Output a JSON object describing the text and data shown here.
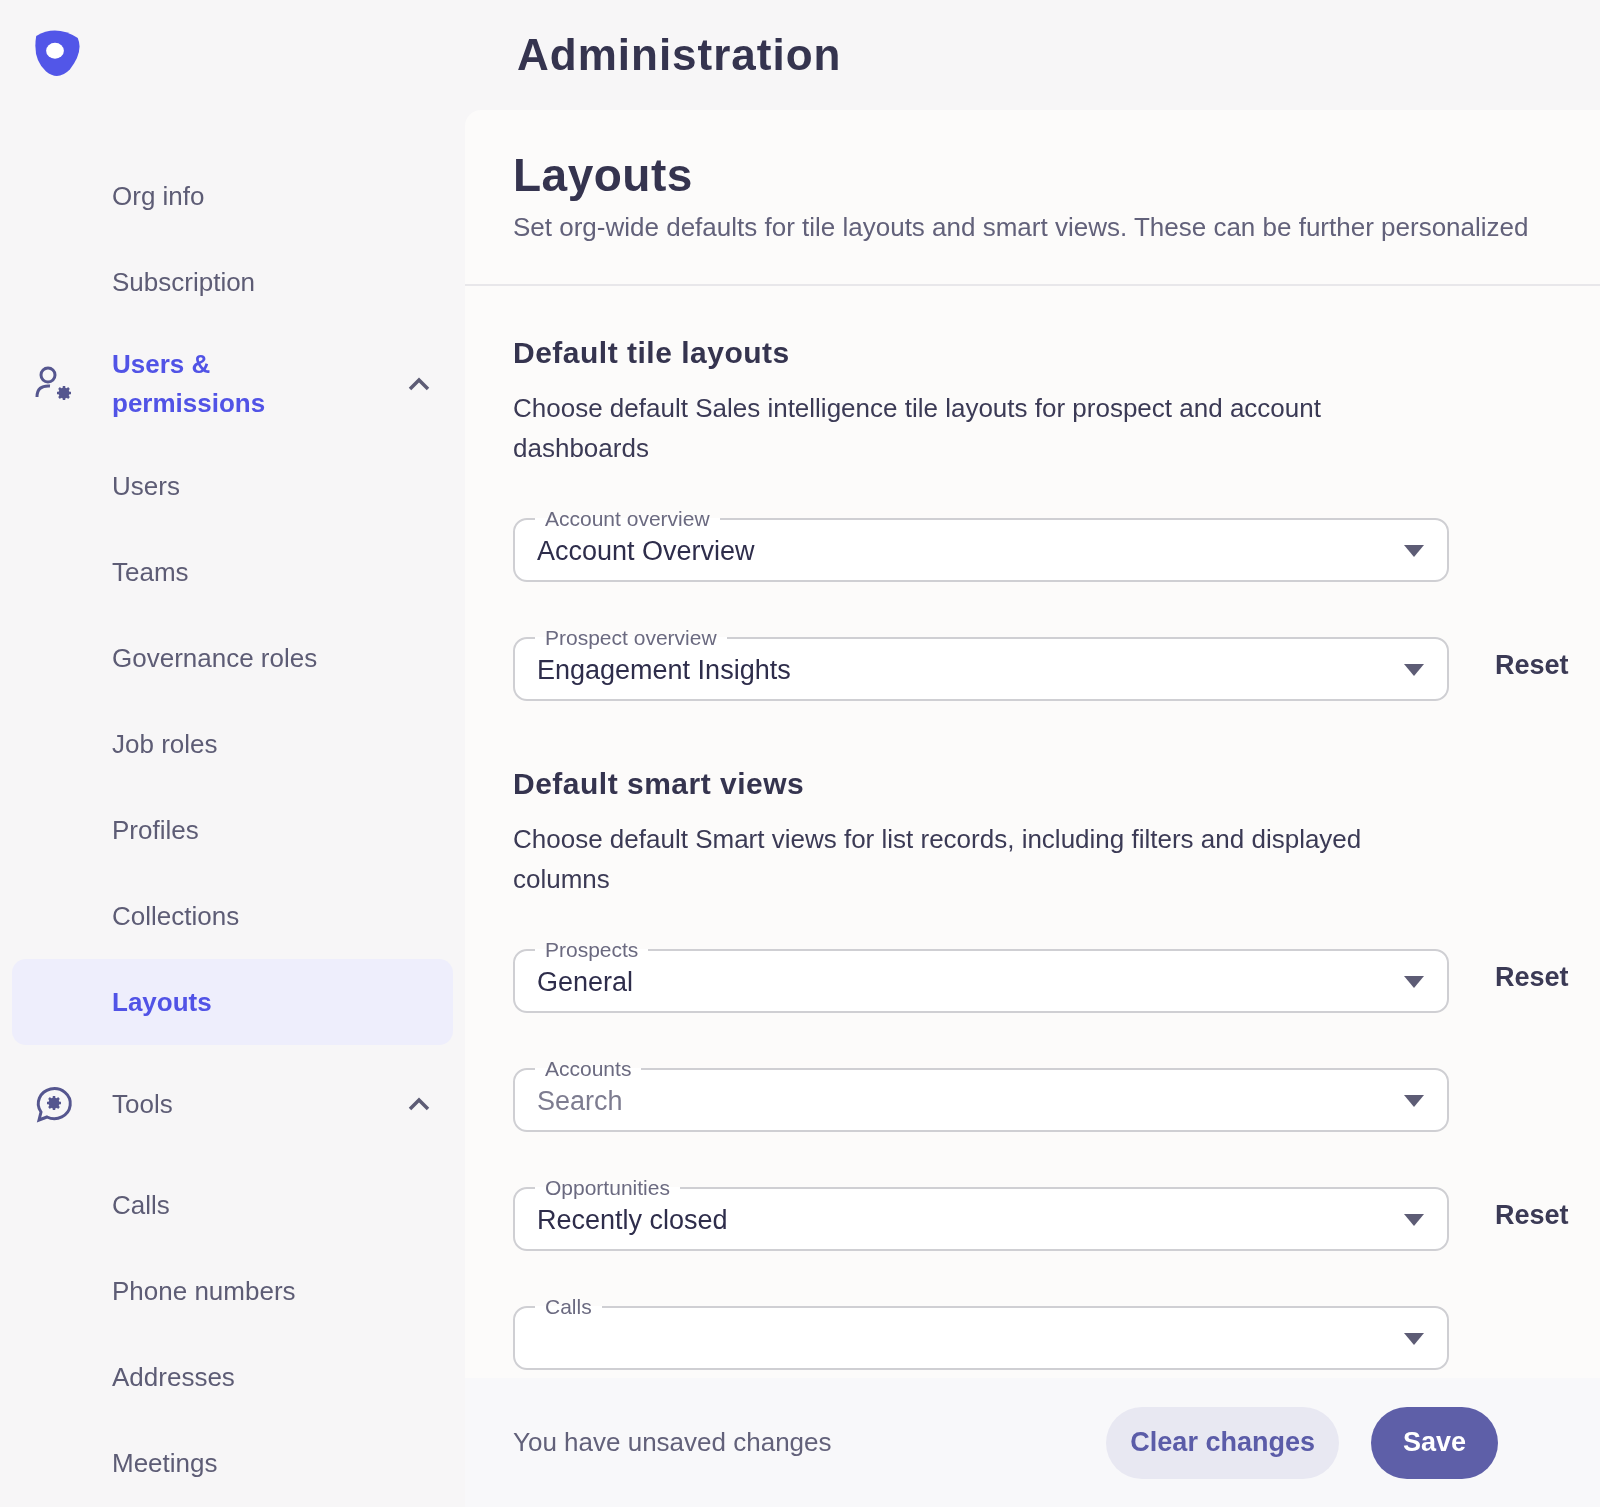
{
  "header": {
    "title": "Administration"
  },
  "sidebar": {
    "items": [
      {
        "kind": "link",
        "label": "Org info",
        "selected": false
      },
      {
        "kind": "link",
        "label": "Subscription",
        "selected": false
      },
      {
        "kind": "group",
        "label": "Users & permissions",
        "active": true,
        "expanded": true,
        "children": [
          {
            "label": "Users",
            "selected": false
          },
          {
            "label": "Teams",
            "selected": false
          },
          {
            "label": "Governance roles",
            "selected": false
          },
          {
            "label": "Job roles",
            "selected": false
          },
          {
            "label": "Profiles",
            "selected": false
          },
          {
            "label": "Collections",
            "selected": false
          },
          {
            "label": "Layouts",
            "selected": true
          }
        ]
      },
      {
        "kind": "group",
        "label": "Tools",
        "active": false,
        "expanded": true,
        "children": [
          {
            "label": "Calls",
            "selected": false
          },
          {
            "label": "Phone numbers",
            "selected": false
          },
          {
            "label": "Addresses",
            "selected": false
          },
          {
            "label": "Meetings",
            "selected": false
          }
        ]
      }
    ]
  },
  "panel": {
    "title": "Layouts",
    "subtitle": "Set org-wide defaults for tile layouts and smart views. These can be further personalized",
    "sections": [
      {
        "heading": "Default tile layouts",
        "description": "Choose default Sales intelligence tile layouts for prospect and account dashboards",
        "fields": [
          {
            "label": "Account overview",
            "value": "Account Overview"
          },
          {
            "label": "Prospect overview",
            "value": "Engagement Insights",
            "reset": "Reset"
          }
        ]
      },
      {
        "heading": "Default smart views",
        "description": "Choose default Smart views for list records, including filters and displayed columns",
        "fields": [
          {
            "label": "Prospects",
            "value": "General",
            "reset": "Reset"
          },
          {
            "label": "Accounts",
            "placeholder": "Search"
          },
          {
            "label": "Opportunities",
            "value": "Recently closed",
            "reset": "Reset"
          },
          {
            "label": "Calls"
          }
        ]
      }
    ]
  },
  "footer": {
    "message": "You have unsaved changes",
    "buttons": [
      {
        "kind": "secondary",
        "label": "Clear changes"
      },
      {
        "kind": "primary",
        "label": "Save"
      }
    ]
  }
}
